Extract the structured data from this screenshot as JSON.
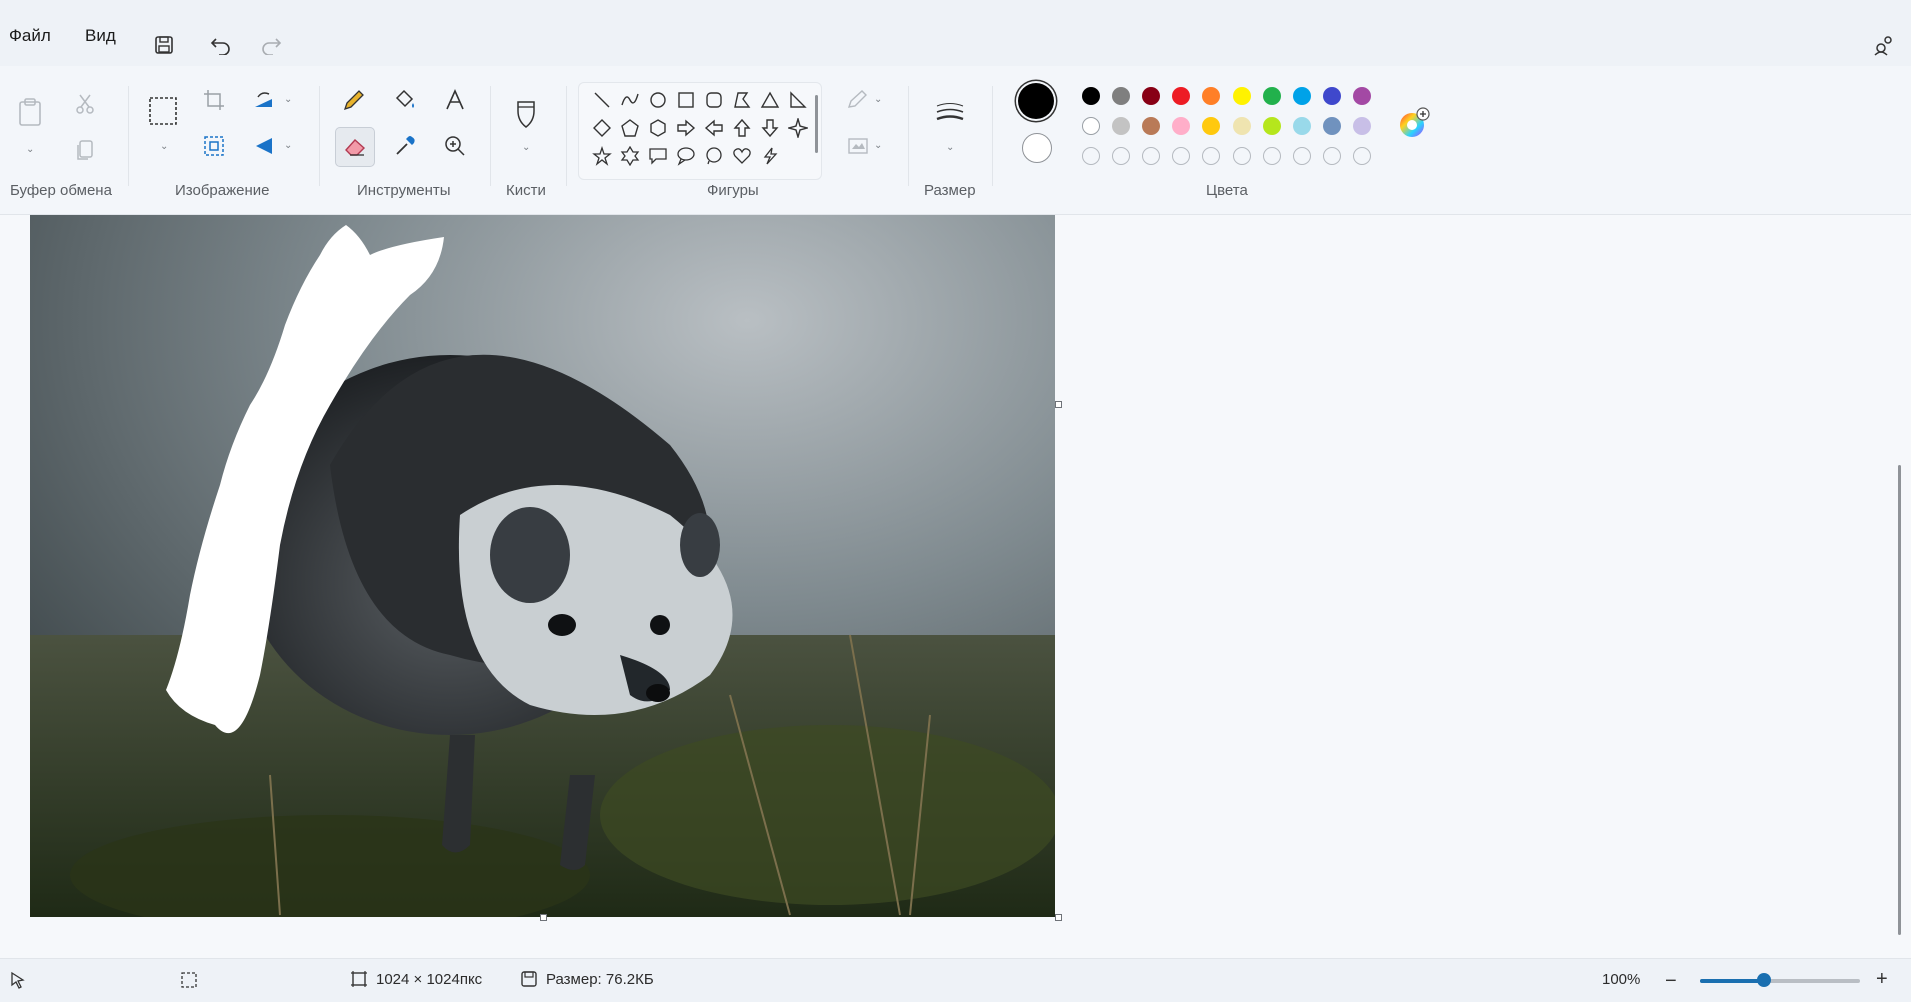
{
  "menu": {
    "file": "Файл",
    "view": "Вид"
  },
  "groups": {
    "clipboard": "Буфер обмена",
    "image": "Изображение",
    "tools": "Инструменты",
    "brushes": "Кисти",
    "shapes": "Фигуры",
    "size": "Размер",
    "colors": "Цвета"
  },
  "primary_color": "#000000",
  "secondary_color": "#ffffff",
  "palette_row1": [
    "#000000",
    "#7f7f7f",
    "#880015",
    "#ed1c24",
    "#ff7f27",
    "#fff200",
    "#22b14c",
    "#00a2e8",
    "#3f48cc",
    "#a349a4"
  ],
  "palette_row2": [
    "#ffffff",
    "#c3c3c3",
    "#b97a57",
    "#ffaec9",
    "#ffc90e",
    "#efe4b0",
    "#b5e61d",
    "#99d9ea",
    "#7092be",
    "#c8bfe7"
  ],
  "status": {
    "dimensions": "1024 × 1024пкс",
    "file_size": "Размер: 76.2КБ",
    "zoom": "100%",
    "zoom_level": 0.4
  },
  "icons": {
    "save": "save-icon",
    "undo": "undo-icon",
    "redo": "redo-icon",
    "eraser": "eraser-icon",
    "color_picker": "color-picker-icon"
  }
}
